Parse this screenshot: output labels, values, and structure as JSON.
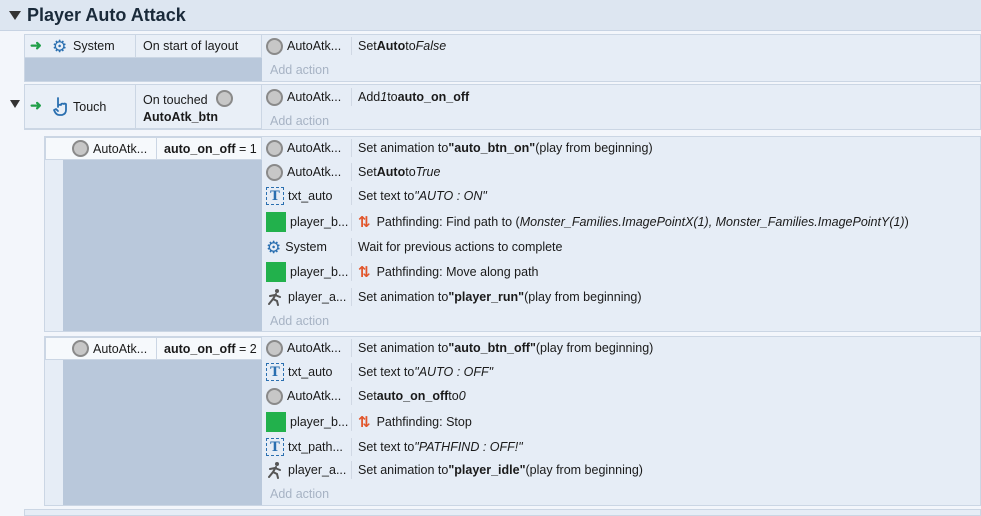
{
  "group": {
    "title": "Player Auto Attack"
  },
  "add_action_label": "Add action",
  "events": [
    {
      "condition": {
        "object": "System",
        "text": "On start of layout"
      },
      "actions": [
        {
          "object": "AutoAtk...",
          "pre": "Set ",
          "b1": "Auto",
          "mid": " to ",
          "it": "False"
        }
      ]
    },
    {
      "condition": {
        "object": "Touch",
        "text_line1": "On touched",
        "text_line2": "AutoAtk_btn"
      },
      "actions": [
        {
          "object": "AutoAtk...",
          "pre": "Add ",
          "it": "1",
          "mid": " to ",
          "b1": "auto_on_off"
        }
      ]
    }
  ],
  "sub1": {
    "condition": {
      "object": "AutoAtk...",
      "var": "auto_on_off",
      "op": " = 1"
    },
    "actions": [
      {
        "object": "AutoAtk...",
        "pre": "Set animation to ",
        "b1": "\"auto_btn_on\"",
        "post": " (play from beginning)"
      },
      {
        "object": "AutoAtk...",
        "pre": "Set ",
        "b1": "Auto",
        "mid": " to ",
        "it": "True"
      },
      {
        "object": "txt_auto",
        "pre": "Set text to ",
        "it": "\"AUTO : ON\""
      },
      {
        "object": "player_b...",
        "pre": "Pathfinding: Find path to (",
        "it": "Monster_Families.ImagePointX(1), Monster_Families.ImagePointY(1)",
        "post": ")"
      },
      {
        "object": "System",
        "pre": "Wait for previous actions to complete"
      },
      {
        "object": "player_b...",
        "pre": "Pathfinding: Move along path"
      },
      {
        "object": "player_a...",
        "pre": "Set animation to ",
        "b1": "\"player_run\"",
        "post": " (play from beginning)"
      }
    ]
  },
  "sub2": {
    "condition": {
      "object": "AutoAtk...",
      "var": "auto_on_off",
      "op": " = 2"
    },
    "actions": [
      {
        "object": "AutoAtk...",
        "pre": "Set animation to ",
        "b1": "\"auto_btn_off\"",
        "post": " (play from beginning)"
      },
      {
        "object": "txt_auto",
        "pre": "Set text to ",
        "it": "\"AUTO : OFF\""
      },
      {
        "object": "AutoAtk...",
        "pre": "Set ",
        "b1": "auto_on_off",
        "mid": " to ",
        "it": "0"
      },
      {
        "object": "player_b...",
        "pre": "Pathfinding: Stop"
      },
      {
        "object": "txt_path...",
        "pre": "Set text to ",
        "it": "\"PATHFIND : OFF!\""
      },
      {
        "object": "player_a...",
        "pre": "Set animation to ",
        "b1": "\"player_idle\"",
        "post": " (play from beginning)"
      }
    ]
  },
  "colors": {
    "green": "#22b14c",
    "path_icon": "#e2552a",
    "text_icon": "#2a6fb0"
  },
  "icons": {
    "system": "gear-icon",
    "touch": "touch-hand-icon",
    "object": "circle-object-icon",
    "sprite": "green-square-icon",
    "text": "text-object-icon",
    "anim": "running-figure-icon",
    "pathfinding": "pathfinding-icon"
  }
}
